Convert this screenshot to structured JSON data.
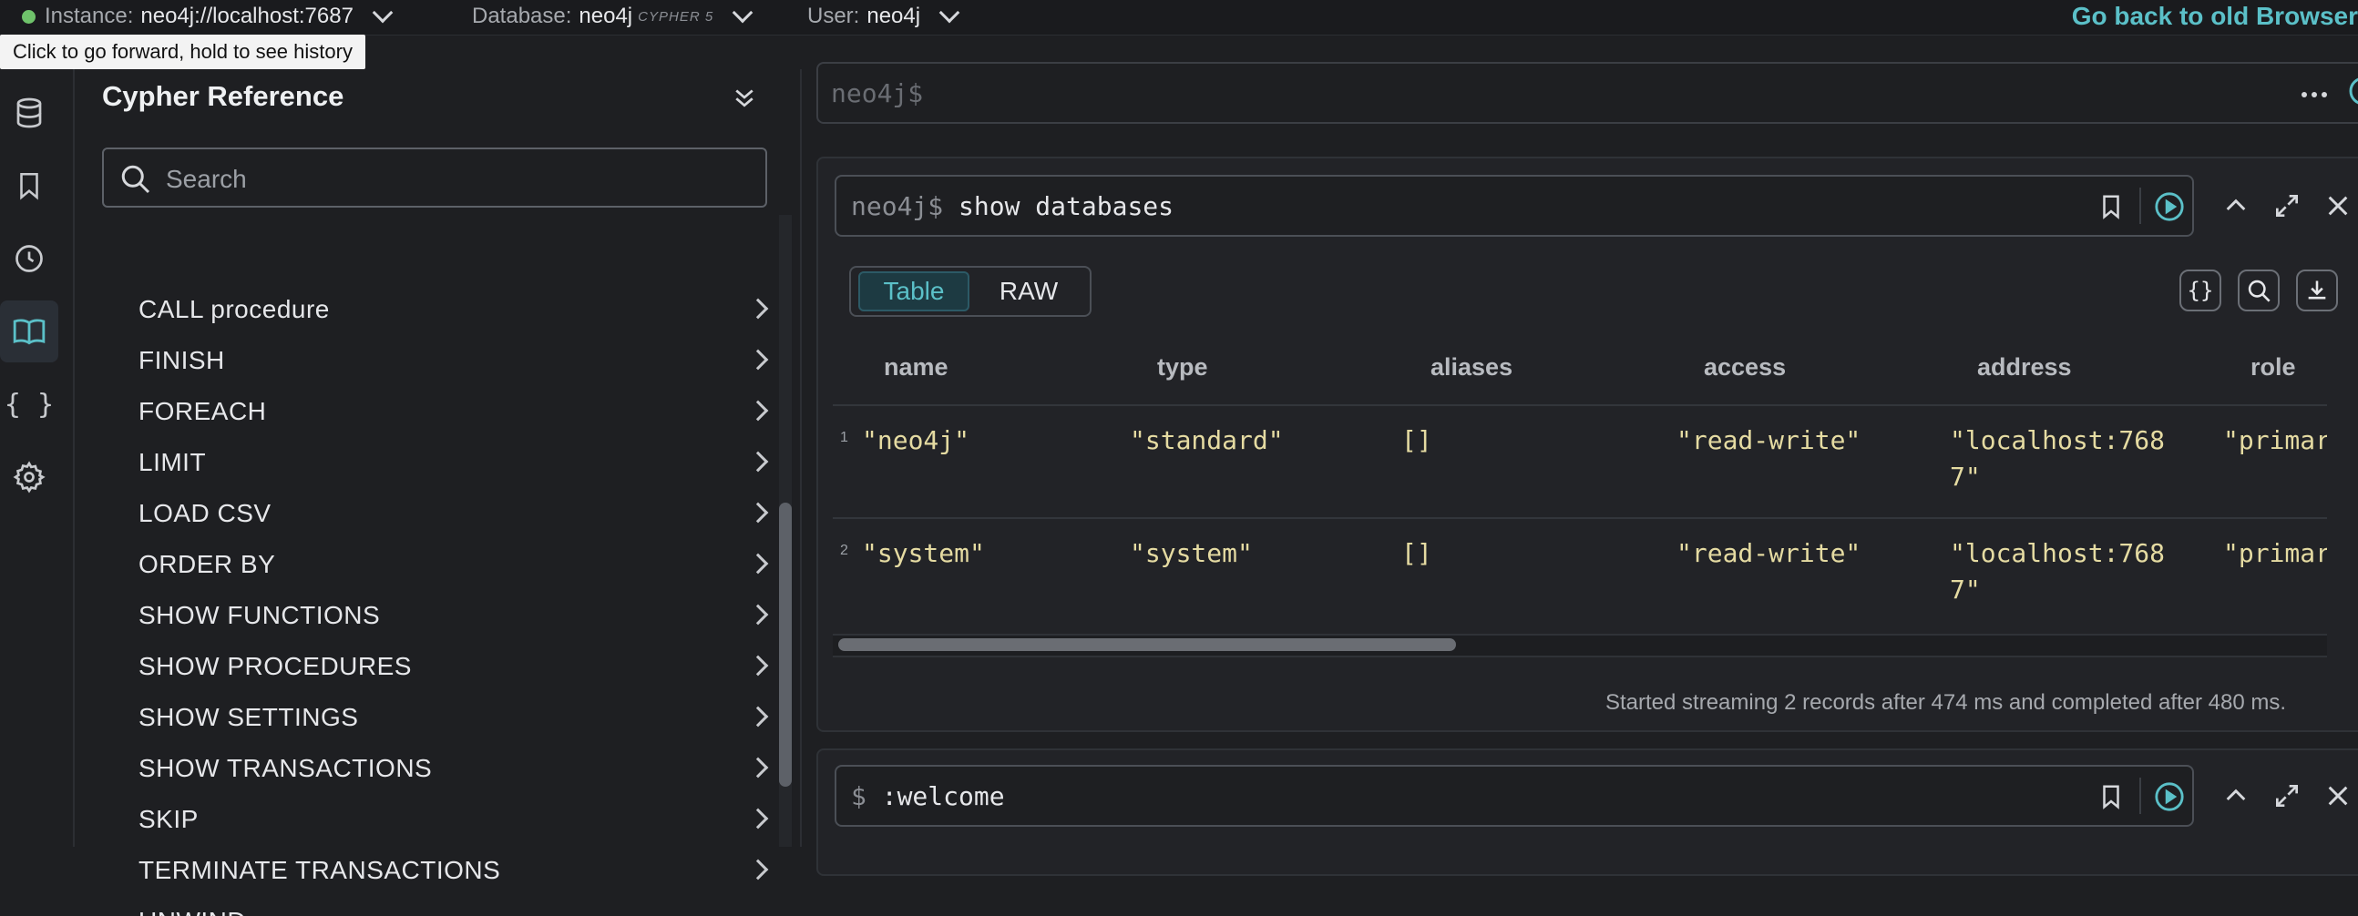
{
  "topbar": {
    "instance_label": "Instance:",
    "instance_value": "neo4j://localhost:7687",
    "database_label": "Database:",
    "database_value": "neo4j",
    "cypher_version": "CYPHER 5",
    "user_label": "User:",
    "user_value": "neo4j",
    "go_back": "Go back to old Browser",
    "status_color": "#6fc36b",
    "accent_color": "#5bc0c8"
  },
  "tooltip": "Click to go forward, hold to see history",
  "rail": {
    "icons": [
      "database-icon",
      "bookmark-icon",
      "history-icon",
      "book-icon",
      "braces-icon",
      "gear-icon"
    ],
    "active": "book-icon"
  },
  "drawer": {
    "title": "Cypher Reference",
    "search_placeholder": "Search",
    "items": [
      "CALL procedure",
      "FINISH",
      "FOREACH",
      "LIMIT",
      "LOAD CSV",
      "ORDER BY",
      "SHOW FUNCTIONS",
      "SHOW PROCEDURES",
      "SHOW SETTINGS",
      "SHOW TRANSACTIONS",
      "SKIP",
      "TERMINATE TRANSACTIONS",
      "UNWIND"
    ]
  },
  "editor": {
    "prompt": "neo4j$"
  },
  "frame1": {
    "prompt": "neo4j$",
    "query": "show databases",
    "view_tabs": [
      "Table",
      "RAW"
    ],
    "active_tab": "Table",
    "columns": [
      "name",
      "type",
      "aliases",
      "access",
      "address",
      "role"
    ],
    "rows": [
      {
        "n": "1",
        "name": "\"neo4j\"",
        "type": "\"standard\"",
        "aliases": "[]",
        "access": "\"read-write\"",
        "address_1": "\"localhost:768",
        "address_2": "7\"",
        "role": "\"primar"
      },
      {
        "n": "2",
        "name": "\"system\"",
        "type": "\"system\"",
        "aliases": "[]",
        "access": "\"read-write\"",
        "address_1": "\"localhost:768",
        "address_2": "7\"",
        "role": "\"primar"
      }
    ],
    "status": "Started streaming 2 records after 474 ms and completed after 480 ms."
  },
  "frame2": {
    "prompt": "$",
    "query": ":welcome"
  }
}
